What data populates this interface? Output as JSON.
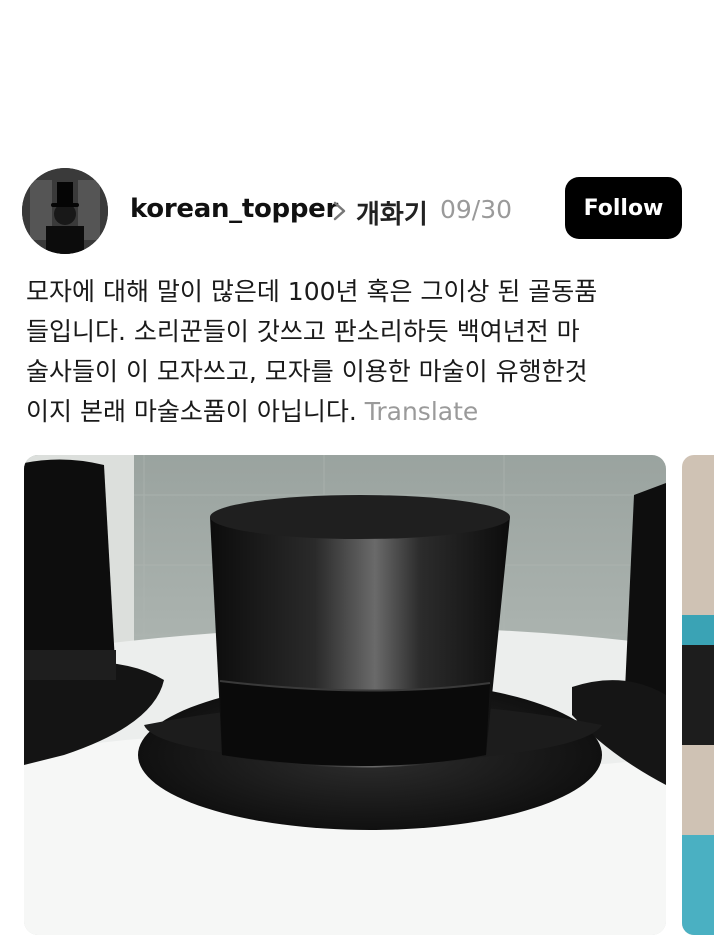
{
  "post": {
    "username": "korean_topper",
    "topic": "개화기",
    "date": "09/30",
    "follow_label": "Follow",
    "text_lines": [
      "모자에 대해 말이 많은데 100년 혹은 그이상 된 골동품",
      "들입니다. 소리꾼들이 갓쓰고 판소리하듯 백여년전 마",
      "술사들이 이 모자쓰고, 모자를 이용한 마술이 유행한것",
      "이지 본래 마술소품이 아닙니다."
    ],
    "translate_label": "Translate"
  },
  "icons": {
    "chevron": "chevron-right-icon"
  },
  "colors": {
    "follow_bg": "#000000",
    "muted_text": "#9a9a9a"
  }
}
